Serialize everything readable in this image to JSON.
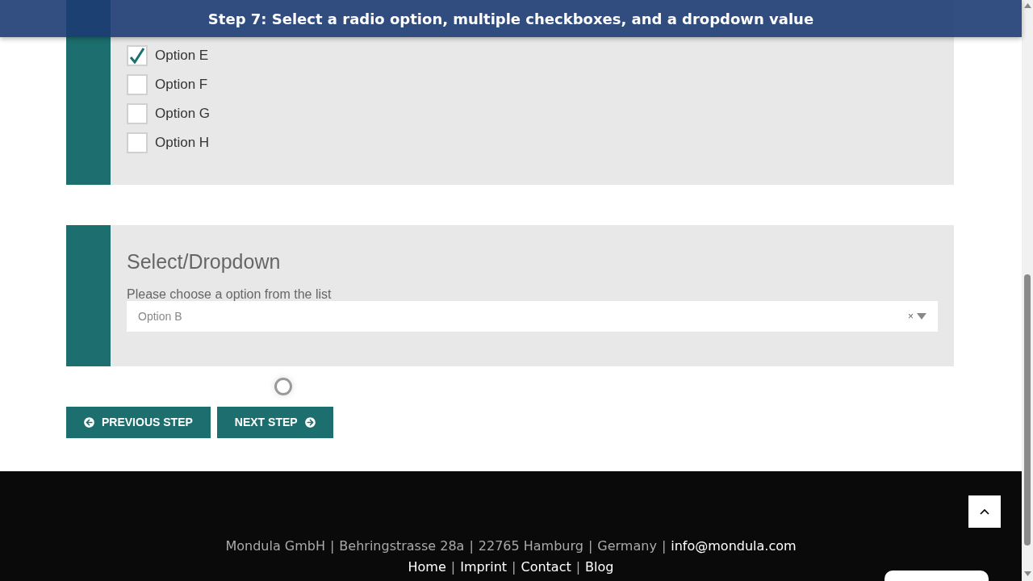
{
  "banner": {
    "title": "Step 7: Select a radio option, multiple checkboxes, and a dropdown value"
  },
  "checkboxes": [
    {
      "label": "Option E",
      "checked": true
    },
    {
      "label": "Option F",
      "checked": false
    },
    {
      "label": "Option G",
      "checked": false
    },
    {
      "label": "Option H",
      "checked": false
    }
  ],
  "select_section": {
    "title": "Select/Dropdown",
    "label": "Please choose a option from the list",
    "value": "Option B",
    "clear": "×"
  },
  "buttons": [
    {
      "kind": "previous",
      "label": "PREVIOUS STEP"
    },
    {
      "kind": "next",
      "label": "NEXT STEP"
    }
  ],
  "footer": {
    "separator": "|",
    "address": [
      "Mondula GmbH",
      "Behringstrasse 28a",
      "22765 Hamburg",
      "Germany"
    ],
    "email": "info@mondula.com",
    "links": [
      "Home",
      "Imprint",
      "Contact",
      "Blog"
    ]
  }
}
